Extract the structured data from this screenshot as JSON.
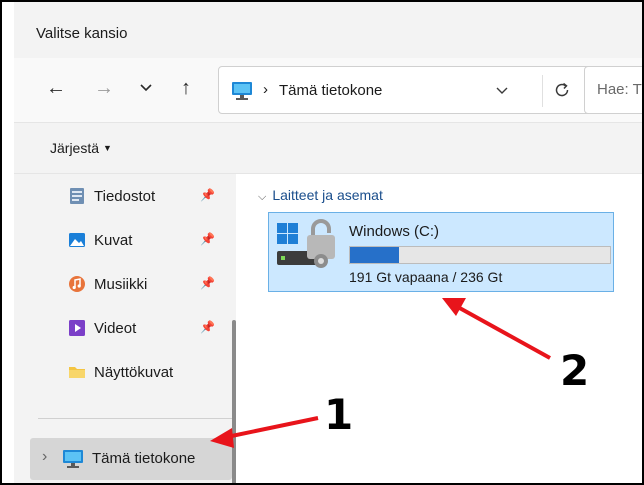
{
  "window": {
    "title": "Valitse kansio"
  },
  "address_bar": {
    "location": "Tämä tietokone",
    "search_placeholder": "Hae: T"
  },
  "command_bar": {
    "organize_label": "Järjestä"
  },
  "nav_pane": {
    "items": [
      {
        "label": "Tiedostot",
        "icon": "documents-icon",
        "pinned": true
      },
      {
        "label": "Kuvat",
        "icon": "pictures-icon",
        "pinned": true
      },
      {
        "label": "Musiikki",
        "icon": "music-icon",
        "pinned": true
      },
      {
        "label": "Videot",
        "icon": "videos-icon",
        "pinned": true
      },
      {
        "label": "Näyttökuvat",
        "icon": "folder-icon",
        "pinned": false
      }
    ],
    "selected": {
      "label": "Tämä tietokone",
      "icon": "computer-icon"
    }
  },
  "content": {
    "group_label": "Laitteet ja asemat",
    "drive": {
      "name": "Windows (C:)",
      "free_text": "191 Gt vapaana / 236 Gt",
      "used_fraction": 0.19
    }
  },
  "annotations": {
    "label_1": "1",
    "label_2": "2"
  },
  "colors": {
    "accent": "#2670c9",
    "selection": "#cce8ff",
    "arrow": "#e8141b"
  }
}
